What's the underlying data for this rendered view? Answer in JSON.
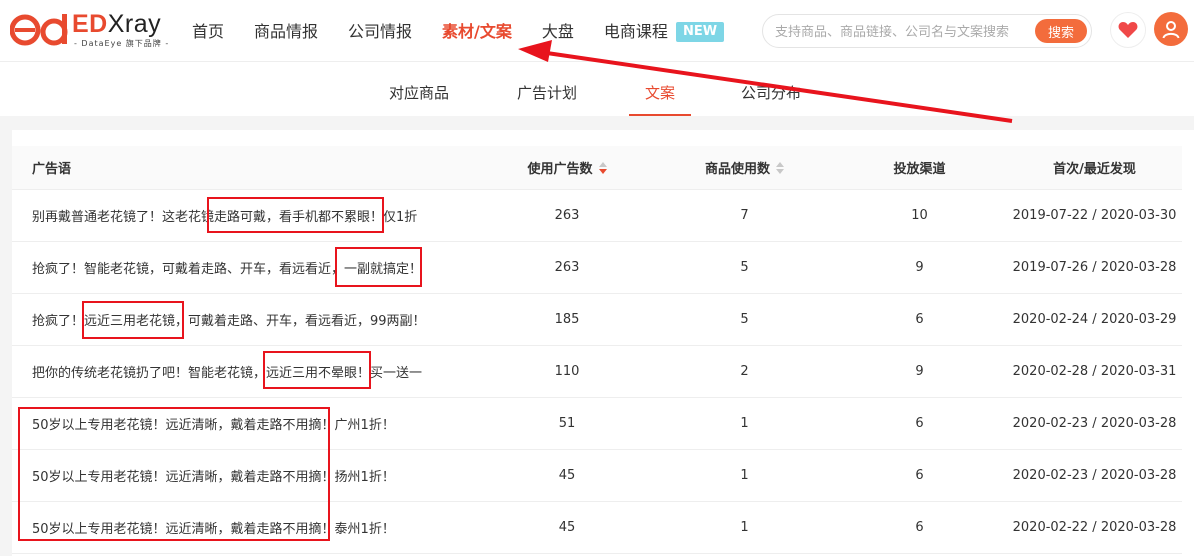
{
  "logo": {
    "brand_prefix": "ED",
    "brand_rest": "Xray",
    "tagline": "- DataEye 旗下品牌 -"
  },
  "nav": {
    "items": [
      {
        "label": "首页"
      },
      {
        "label": "商品情报"
      },
      {
        "label": "公司情报"
      },
      {
        "label": "素材/文案"
      },
      {
        "label": "大盘"
      },
      {
        "label": "电商课程"
      }
    ],
    "active_index": 3,
    "new_badge": "NEW"
  },
  "search": {
    "placeholder": "支持商品、商品链接、公司名与文案搜索",
    "button": "搜索"
  },
  "icons": {
    "favorite": "heart-icon",
    "user": "user-avatar-icon"
  },
  "colors": {
    "accent": "#e84a2f",
    "badge": "#7ed6e6",
    "annotation": "#e8141d"
  },
  "subnav": {
    "tabs": [
      {
        "label": "对应商品"
      },
      {
        "label": "广告计划"
      },
      {
        "label": "文案"
      },
      {
        "label": "公司分布"
      }
    ],
    "active_index": 2
  },
  "table": {
    "columns": [
      "广告语",
      "使用广告数",
      "商品使用数",
      "投放渠道",
      "首次/最近发现"
    ],
    "sorted_column": "使用广告数",
    "sort_direction": "desc",
    "rows": [
      {
        "ad": "别再戴普通老花镜了！这老花镜走路可戴，看手机都不累眼！仅1折",
        "uses": "263",
        "items": "7",
        "channels": "10",
        "dates": "2019-07-22 / 2020-03-30"
      },
      {
        "ad": "抢疯了！智能老花镜，可戴着走路、开车，看远看近，一副就搞定！",
        "uses": "263",
        "items": "5",
        "channels": "9",
        "dates": "2019-07-26 / 2020-03-28"
      },
      {
        "ad": "抢疯了！远近三用老花镜，可戴着走路、开车，看远看近，99两副！",
        "uses": "185",
        "items": "5",
        "channels": "6",
        "dates": "2020-02-24 / 2020-03-29"
      },
      {
        "ad": "把你的传统老花镜扔了吧！智能老花镜，远近三用不晕眼！买一送一",
        "uses": "110",
        "items": "2",
        "channels": "9",
        "dates": "2020-02-28 / 2020-03-31"
      },
      {
        "ad": "50岁以上专用老花镜！远近清晰，戴着走路不用摘！广州1折！",
        "uses": "51",
        "items": "1",
        "channels": "6",
        "dates": "2020-02-23 / 2020-03-28"
      },
      {
        "ad": "50岁以上专用老花镜！远近清晰，戴着走路不用摘！扬州1折！",
        "uses": "45",
        "items": "1",
        "channels": "6",
        "dates": "2020-02-23 / 2020-03-28"
      },
      {
        "ad": "50岁以上专用老花镜！远近清晰，戴着走路不用摘！泰州1折！",
        "uses": "45",
        "items": "1",
        "channels": "6",
        "dates": "2020-02-22 / 2020-03-28"
      }
    ]
  }
}
